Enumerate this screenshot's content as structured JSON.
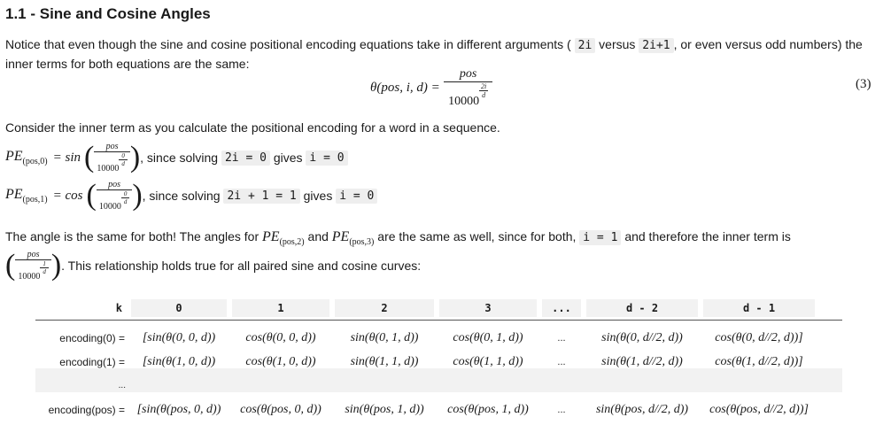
{
  "heading": "1.1 - Sine and Cosine Angles",
  "intro": {
    "p1": "Notice that even though the sine and cosine positional encoding equations take in different arguments (",
    "code1": "2i",
    "p2": "versus",
    "code2": "2i+1",
    "p3": ", or even versus odd numbers) the inner terms for both equations are the same:"
  },
  "equation": {
    "lhs": "θ(pos, i, d) =",
    "num": "pos",
    "den_base": "10000",
    "exp_num": "2i",
    "exp_den": "d",
    "number": "(3)"
  },
  "consider": "Consider the inner term as you calculate the positional encoding for a word in a sequence.",
  "pe0": {
    "lhs": "PE",
    "sub": "(pos,0)",
    "fn": "= sin",
    "num": "pos",
    "den_base": "10000",
    "exp_num": "0",
    "exp_den": "d",
    "text1": ", since solving",
    "code1": "2i = 0",
    "text2": "gives",
    "code2": "i = 0"
  },
  "pe1": {
    "lhs": "PE",
    "sub": "(pos,1)",
    "fn": "= cos",
    "num": "pos",
    "den_base": "10000",
    "exp_num": "0",
    "exp_den": "d",
    "text1": ", since solving",
    "code1": "2i + 1 = 1",
    "text2": "gives",
    "code2": "i = 0"
  },
  "angle": {
    "t1": "The angle is the same for both! The angles for",
    "pe": "PE",
    "sub2": "(pos,2)",
    "t2": "and",
    "sub3": "(pos,3)",
    "t3": "are the same as well, since for both,",
    "code": "i = 1",
    "t4": "and therefore the inner term is"
  },
  "angle2": {
    "num": "pos",
    "den_base": "10000",
    "exp_num": "1",
    "exp_den": "d",
    "text": ". This relationship holds true for all paired sine and cosine curves:"
  },
  "table": {
    "headers": [
      "k",
      "0",
      "1",
      "2",
      "3",
      "...",
      "d - 2",
      "d - 1"
    ],
    "rows": [
      {
        "label": "encoding(0) =",
        "cells": [
          "[sin(θ(0, 0, d))",
          "cos(θ(0, 0, d))",
          "sin(θ(0, 1, d))",
          "cos(θ(0, 1, d))",
          "...",
          "sin(θ(0, d//2, d))",
          "cos(θ(0, d//2, d))]"
        ]
      },
      {
        "label": "encoding(1) =",
        "cells": [
          "[sin(θ(1, 0, d))",
          "cos(θ(1, 0, d))",
          "sin(θ(1, 1, d))",
          "cos(θ(1, 1, d))",
          "...",
          "sin(θ(1, d//2, d))",
          "cos(θ(1, d//2, d))]"
        ]
      },
      {
        "label": "...",
        "cells": [
          "",
          "",
          "",
          "",
          "",
          "",
          ""
        ]
      },
      {
        "label": "encoding(pos) =",
        "cells": [
          "[sin(θ(pos, 0, d))",
          "cos(θ(pos, 0, d))",
          "sin(θ(pos, 1, d))",
          "cos(θ(pos, 1, d))",
          "...",
          "sin(θ(pos, d//2, d))",
          "cos(θ(pos, d//2, d))]"
        ]
      }
    ]
  }
}
